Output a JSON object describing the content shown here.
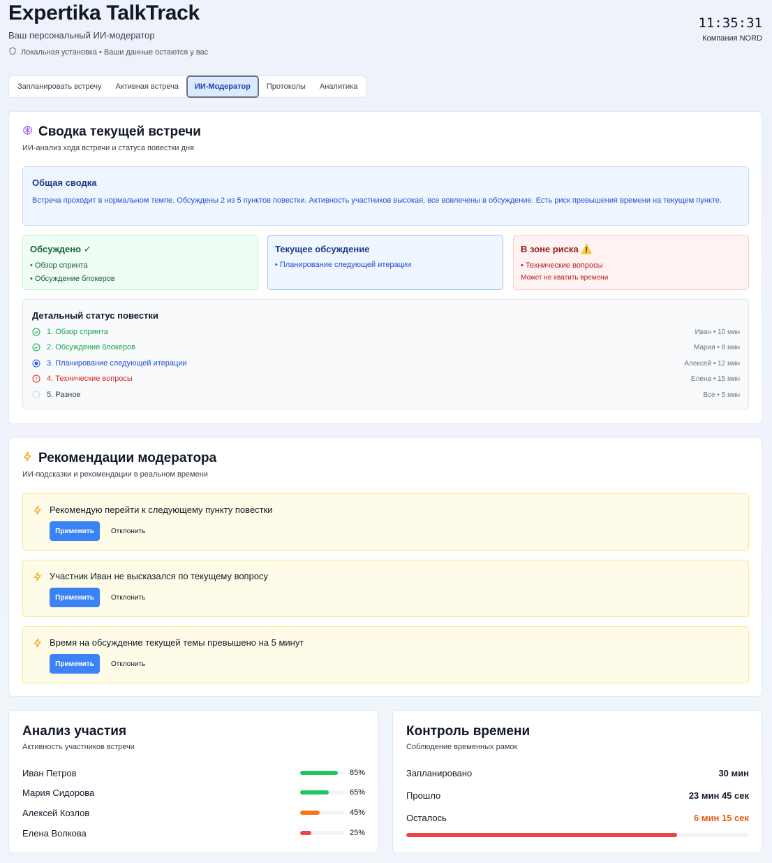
{
  "header": {
    "title": "Expertika TalkTrack",
    "subtitle": "Ваш персональный ИИ-модератор",
    "local_note": "Локальная установка • Ваши данные остаются у вас",
    "clock": "11:35:31",
    "company": "Компания NORD"
  },
  "tabs": [
    {
      "label": "Запланировать встречу",
      "active": false
    },
    {
      "label": "Активная встреча",
      "active": false
    },
    {
      "label": "ИИ-Модератор",
      "active": true
    },
    {
      "label": "Протоколы",
      "active": false
    },
    {
      "label": "Аналитика",
      "active": false
    }
  ],
  "summary_card": {
    "title": "Сводка текущей встречи",
    "subtitle": "ИИ-анализ хода встречи и статуса повестки дня",
    "general": {
      "title": "Общая сводка",
      "text": "Встреча проходит в нормальном темпе. Обсуждены 2 из 5 пунктов повестки. Активность участников высокая, все вовлечены в обсуждение. Есть риск превышения времени на текущем пункте."
    },
    "discussed": {
      "title": "Обсуждено ✓",
      "items": [
        "• Обзор спринта",
        "• Обсуждение блокеров"
      ]
    },
    "current": {
      "title": "Текущее обсуждение",
      "items": [
        "• Планирование следующей итерации"
      ]
    },
    "risk": {
      "title": "В зоне риска ⚠️",
      "items": [
        "• Технические вопросы"
      ],
      "note": "Может не хватить времени"
    },
    "agenda": {
      "title": "Детальный статус повестки",
      "items": [
        {
          "label": "1. Обзор спринта",
          "meta": "Иван  •  10 мин",
          "status": "done"
        },
        {
          "label": "2. Обсуждение блокеров",
          "meta": "Мария  •  8 мин",
          "status": "done"
        },
        {
          "label": "3. Планирование следующей итерации",
          "meta": "Алексей  •  12 мин",
          "status": "current"
        },
        {
          "label": "4. Технические вопросы",
          "meta": "Елена  •  15 мин",
          "status": "risk"
        },
        {
          "label": "5. Разное",
          "meta": "Все  •  5 мин",
          "status": "pending"
        }
      ]
    }
  },
  "recommendations": {
    "title": "Рекомендации модератора",
    "subtitle": "ИИ-подсказки и рекомендации в реальном времени",
    "apply_label": "Применить",
    "reject_label": "Отклонить",
    "items": [
      "Рекомендую перейти к следующему пункту повестки",
      "Участник Иван не высказался по текущему вопросу",
      "Время на обсуждение текущей темы превышено на 5 минут"
    ]
  },
  "participation": {
    "title": "Анализ участия",
    "subtitle": "Активность участников встречи",
    "participants": [
      {
        "name": "Иван Петров",
        "percent": 85,
        "label": "85%",
        "color": "#22c55e"
      },
      {
        "name": "Мария Сидорова",
        "percent": 65,
        "label": "65%",
        "color": "#22c55e"
      },
      {
        "name": "Алексей Козлов",
        "percent": 45,
        "label": "45%",
        "color": "#f97316"
      },
      {
        "name": "Елена Волкова",
        "percent": 25,
        "label": "25%",
        "color": "#ef4444"
      }
    ]
  },
  "time_control": {
    "title": "Контроль времени",
    "subtitle": "Соблюдение временных рамок",
    "rows": [
      {
        "key": "Запланировано",
        "value": "30 мин"
      },
      {
        "key": "Прошло",
        "value": "23 мин 45 сек"
      },
      {
        "key": "Осталось",
        "value": "6 мин 15 сек"
      }
    ],
    "progress_percent": 79
  }
}
